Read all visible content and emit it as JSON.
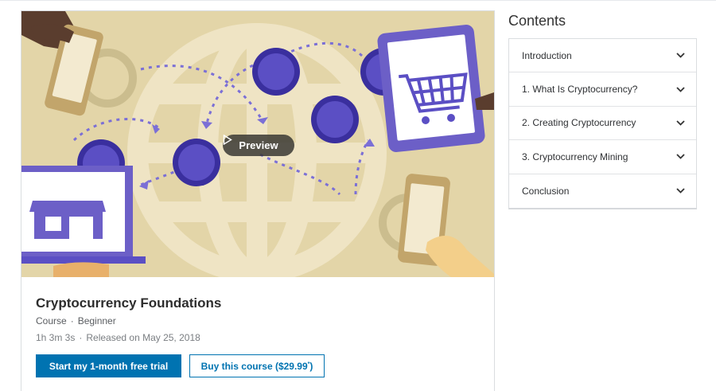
{
  "hero": {
    "preview_label": "Preview",
    "icons": [
      "globe",
      "hand-holding-phone",
      "tablet-shopping-cart",
      "laptop-storefront",
      "coin",
      "phone-in-hand"
    ],
    "colors": {
      "background": "#e3d5a8",
      "coin": "#5b4fc4",
      "device": "#6c5fc7",
      "globe": "#efe4c4"
    }
  },
  "course": {
    "title": "Cryptocurrency Foundations",
    "type": "Course",
    "level": "Beginner",
    "duration": "1h 3m 3s",
    "released": "Released on May 25, 2018"
  },
  "actions": {
    "trial_label": "Start my 1-month free trial",
    "buy_label": "Buy this course ($29.99",
    "buy_mark": "*",
    "buy_suffix": ")"
  },
  "contents": {
    "heading": "Contents",
    "items": [
      {
        "label": "Introduction"
      },
      {
        "label": "1. What Is Cryptocurrency?"
      },
      {
        "label": "2. Creating Cryptocurrency"
      },
      {
        "label": "3. Cryptocurrency Mining"
      },
      {
        "label": "Conclusion"
      }
    ]
  },
  "colors": {
    "accent": "#0073b1",
    "text": "#313335",
    "border": "#dadde0"
  }
}
